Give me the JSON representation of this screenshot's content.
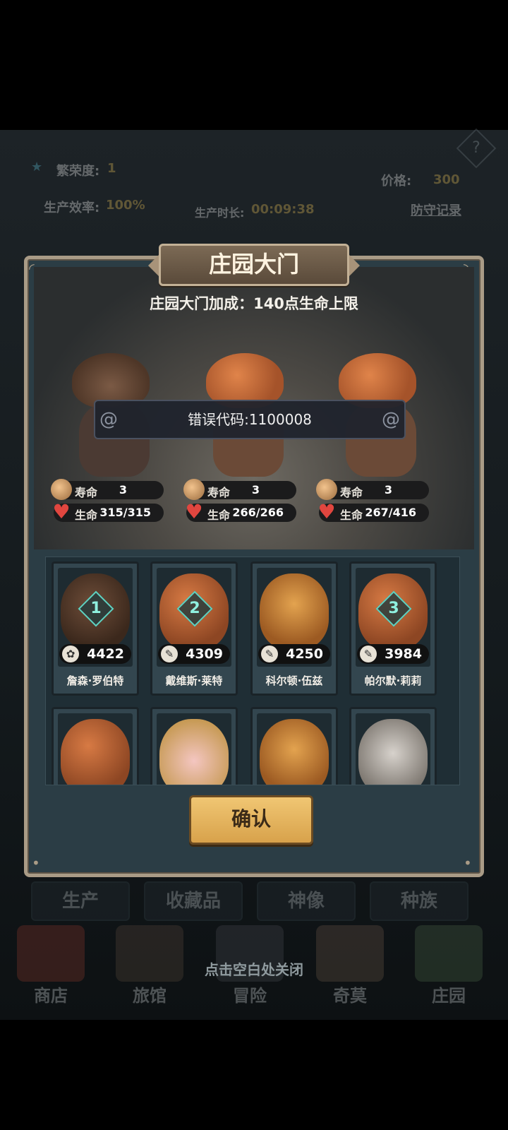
{
  "background": {
    "prosperity_label": "繁荣度:",
    "prosperity_value": "1",
    "efficiency_label": "生产效率:",
    "efficiency_value": "100%",
    "production_time_label": "生产时长:",
    "production_time_value": "00:09:38",
    "price_label": "价格:",
    "price_value": "300",
    "defense_log": "防守记录",
    "help": "?",
    "tabs": [
      "生产",
      "收藏品",
      "神像",
      "种族"
    ],
    "nav": [
      {
        "label": "商店",
        "icon": "shop-icon",
        "color": "#8a3b2c"
      },
      {
        "label": "旅馆",
        "icon": "inn-icon",
        "color": "#5a4a3c"
      },
      {
        "label": "冒险",
        "icon": "adventure-icon",
        "color": "#4a4e52"
      },
      {
        "label": "奇莫",
        "icon": "qimo-icon",
        "color": "#6d5a48"
      },
      {
        "label": "庄园",
        "icon": "manor-icon",
        "color": "#4c6a4a"
      }
    ],
    "close_hint": "点击空白处关闭"
  },
  "dialog": {
    "title": "庄园大门",
    "bonus": "庄园大门加成：140点生命上限",
    "error": "错误代码:1100008",
    "confirm": "确认"
  },
  "team": [
    {
      "life_label": "寿命",
      "life": "3",
      "hp_label": "生命",
      "hp": "315/315",
      "kind": "hat"
    },
    {
      "life_label": "寿命",
      "life": "3",
      "hp_label": "生命",
      "hp": "266/266",
      "kind": "pumpkin"
    },
    {
      "life_label": "寿命",
      "life": "3",
      "hp_label": "生命",
      "hp": "267/416",
      "kind": "pumpkin"
    }
  ],
  "roster": [
    {
      "name": "詹森·罗伯特",
      "power": "4422",
      "rank": "1",
      "face": "hat"
    },
    {
      "name": "戴维斯·莱特",
      "power": "4309",
      "rank": "2",
      "face": "pumpkin"
    },
    {
      "name": "科尔顿·伍兹",
      "power": "4250",
      "rank": "",
      "face": "tiger"
    },
    {
      "name": "帕尔默·莉莉",
      "power": "3984",
      "rank": "3",
      "face": "pumpkin"
    },
    {
      "name": "",
      "power": "",
      "rank": "",
      "face": "pumpkin"
    },
    {
      "name": "",
      "power": "",
      "rank": "",
      "face": "blonde"
    },
    {
      "name": "",
      "power": "",
      "rank": "",
      "face": "tiger"
    },
    {
      "name": "",
      "power": "",
      "rank": "",
      "face": "skull"
    }
  ]
}
